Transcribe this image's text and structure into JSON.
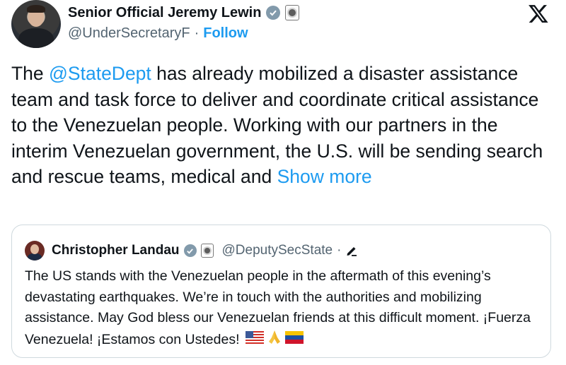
{
  "author": {
    "name": "Senior Official Jeremy Lewin",
    "handle": "@UnderSecretaryF",
    "separator": "·",
    "follow_label": "Follow"
  },
  "tweet": {
    "prefix": "The ",
    "mention": "@StateDept",
    "text": " has already mobilized a disaster assistance team and task force to deliver and coordinate critical assistance to the Venezuelan people. Working with our partners in the interim Venezuelan government, the U.S. will be sending search and rescue teams, medical and ",
    "show_more": "Show more"
  },
  "quoted": {
    "name": "Christopher Landau",
    "handle": "@DeputySecState",
    "separator": "·",
    "text": "The US stands with the Venezuelan people in the aftermath of this evening’s devastating earthquakes. We’re in touch with the authorities and mobilizing assistance. May God bless our Venezuelan friends at this difficult moment. ¡Fuerza Venezuela! ¡Estamos con Ustedes!",
    "emojis": [
      "us-flag-icon",
      "praying-hands-icon",
      "venezuela-flag-icon"
    ]
  },
  "colors": {
    "link": "#1d9bf0",
    "text": "#0f1419",
    "muted": "#536471",
    "verified_badge": "#829aab",
    "border": "#cfd9de"
  }
}
